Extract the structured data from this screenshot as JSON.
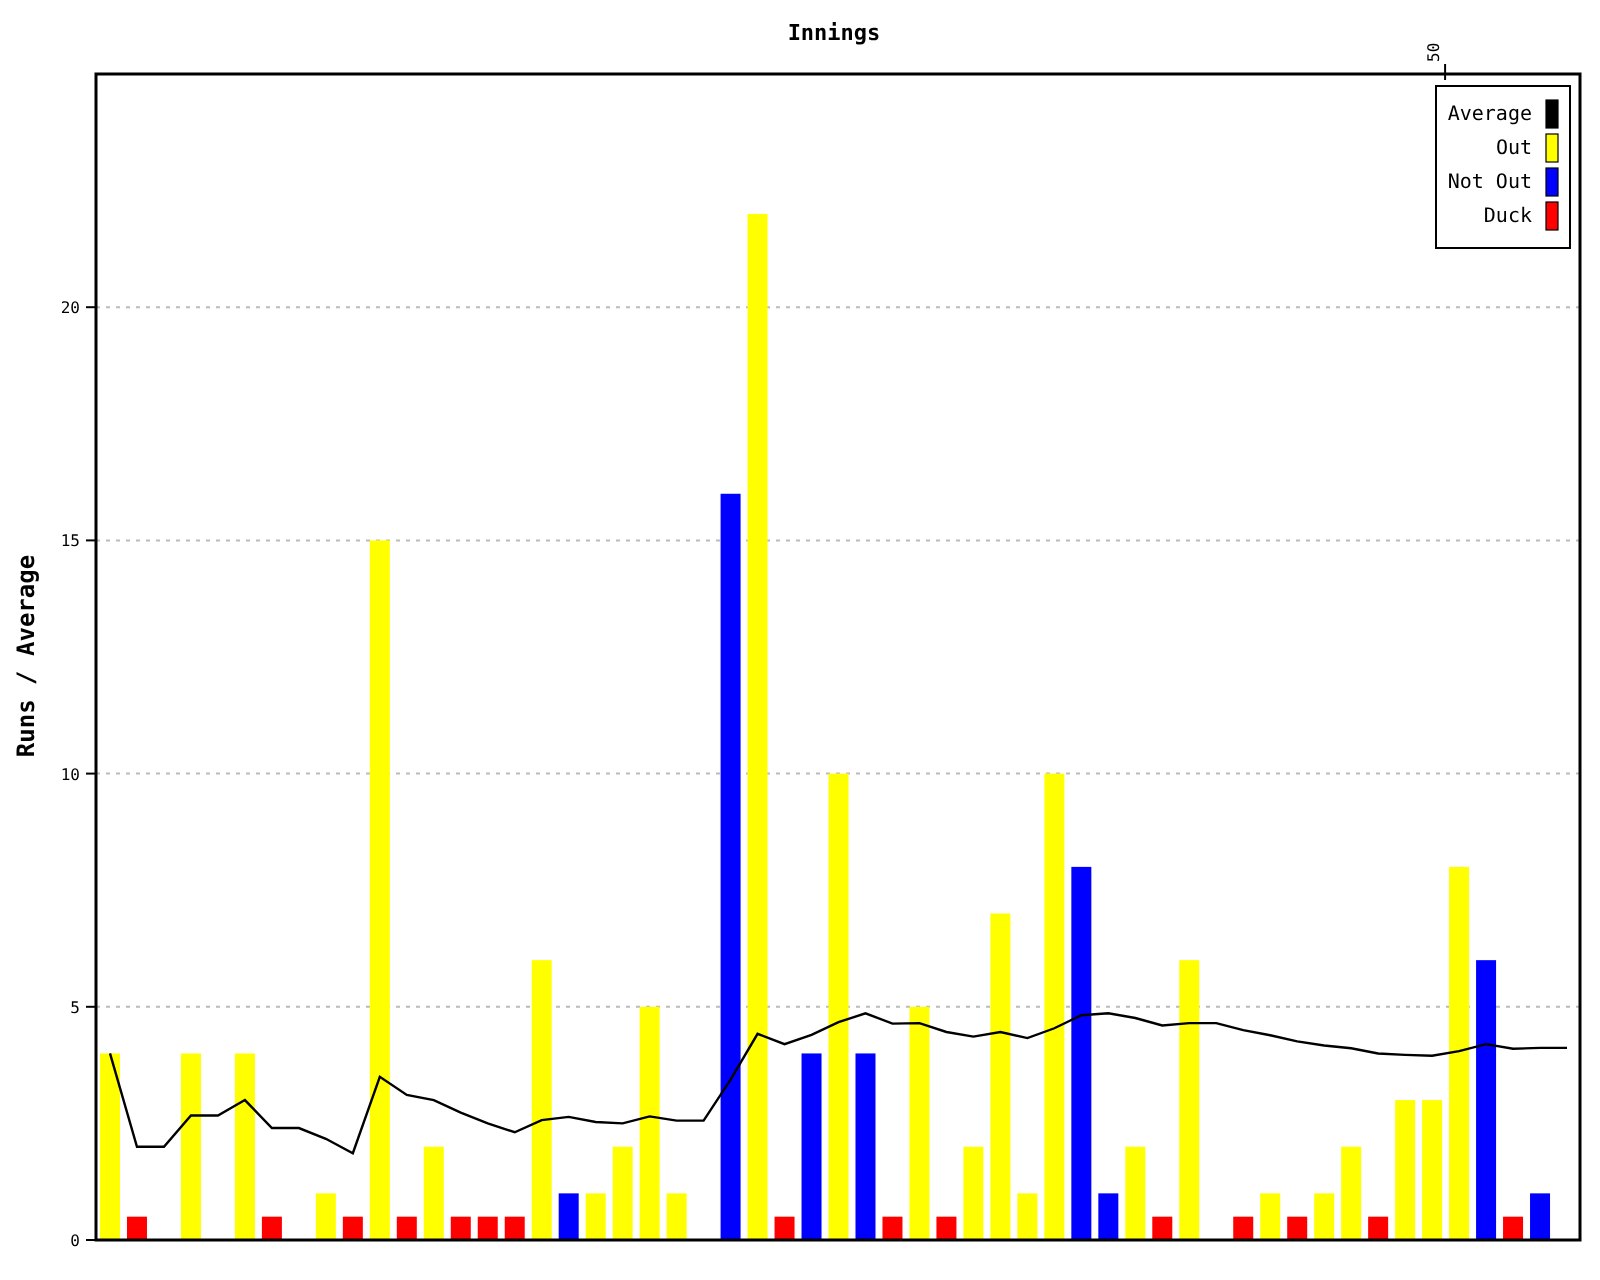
{
  "chart_data": {
    "type": "bar",
    "title": "Innings",
    "ylabel": "Runs / Average",
    "grid": true,
    "legend": true,
    "ylim": [
      0,
      25
    ],
    "yticks": [
      {
        "value": 0,
        "label": "0"
      },
      {
        "value": 5,
        "label": "5"
      },
      {
        "value": 10,
        "label": "10"
      },
      {
        "value": 15,
        "label": "15"
      },
      {
        "value": 20,
        "label": "20"
      }
    ],
    "series": [
      {
        "name": "Average",
        "type": "line",
        "color": "#000000",
        "values": [
          4,
          2,
          2,
          2.67,
          2.67,
          3,
          2.4,
          2.4,
          2.17,
          1.86,
          3.5,
          3.11,
          3,
          2.73,
          2.5,
          2.31,
          2.57,
          2.64,
          2.53,
          2.5,
          2.65,
          2.56,
          2.56,
          3.44,
          4.42,
          4.2,
          4.4,
          4.67,
          4.86,
          4.64,
          4.65,
          4.46,
          4.36,
          4.46,
          4.33,
          4.54,
          4.82,
          4.86,
          4.76,
          4.6,
          4.65,
          4.65,
          4.5,
          4.39,
          4.26,
          4.17,
          4.11,
          4,
          3.97,
          3.95,
          4.05,
          4.2,
          4.1,
          4.12,
          4.12
        ]
      },
      {
        "name": "Out",
        "color": "#ffff00",
        "values": [
          4,
          null,
          null,
          4,
          null,
          4,
          null,
          null,
          1,
          null,
          15,
          null,
          2,
          null,
          null,
          null,
          6,
          null,
          1,
          2,
          5,
          1,
          null,
          null,
          22,
          null,
          null,
          10,
          null,
          null,
          5,
          null,
          2,
          7,
          1,
          10,
          null,
          null,
          2,
          null,
          6,
          null,
          null,
          1,
          null,
          1,
          2,
          null,
          3,
          3,
          8,
          null,
          null,
          null,
          null
        ]
      },
      {
        "name": "Not Out",
        "color": "#0000ff",
        "values": [
          null,
          null,
          0,
          null,
          0,
          null,
          null,
          0,
          null,
          null,
          null,
          null,
          null,
          null,
          null,
          null,
          null,
          1,
          null,
          null,
          null,
          null,
          0,
          16,
          null,
          null,
          4,
          null,
          4,
          null,
          null,
          null,
          null,
          null,
          null,
          null,
          8,
          1,
          null,
          null,
          null,
          0,
          null,
          null,
          null,
          null,
          null,
          null,
          null,
          null,
          null,
          6,
          null,
          1,
          0
        ]
      },
      {
        "name": "Duck",
        "color": "#ff0000",
        "values": [
          null,
          0,
          null,
          null,
          null,
          null,
          0,
          null,
          null,
          0,
          null,
          0,
          null,
          0,
          0,
          0,
          null,
          null,
          null,
          null,
          null,
          null,
          null,
          null,
          null,
          0,
          null,
          null,
          null,
          0,
          null,
          0,
          null,
          null,
          null,
          null,
          null,
          null,
          null,
          0,
          null,
          null,
          0,
          null,
          0,
          null,
          null,
          0,
          null,
          null,
          null,
          null,
          0,
          null,
          null
        ]
      }
    ]
  },
  "top_axis_marker": {
    "label": "50"
  }
}
